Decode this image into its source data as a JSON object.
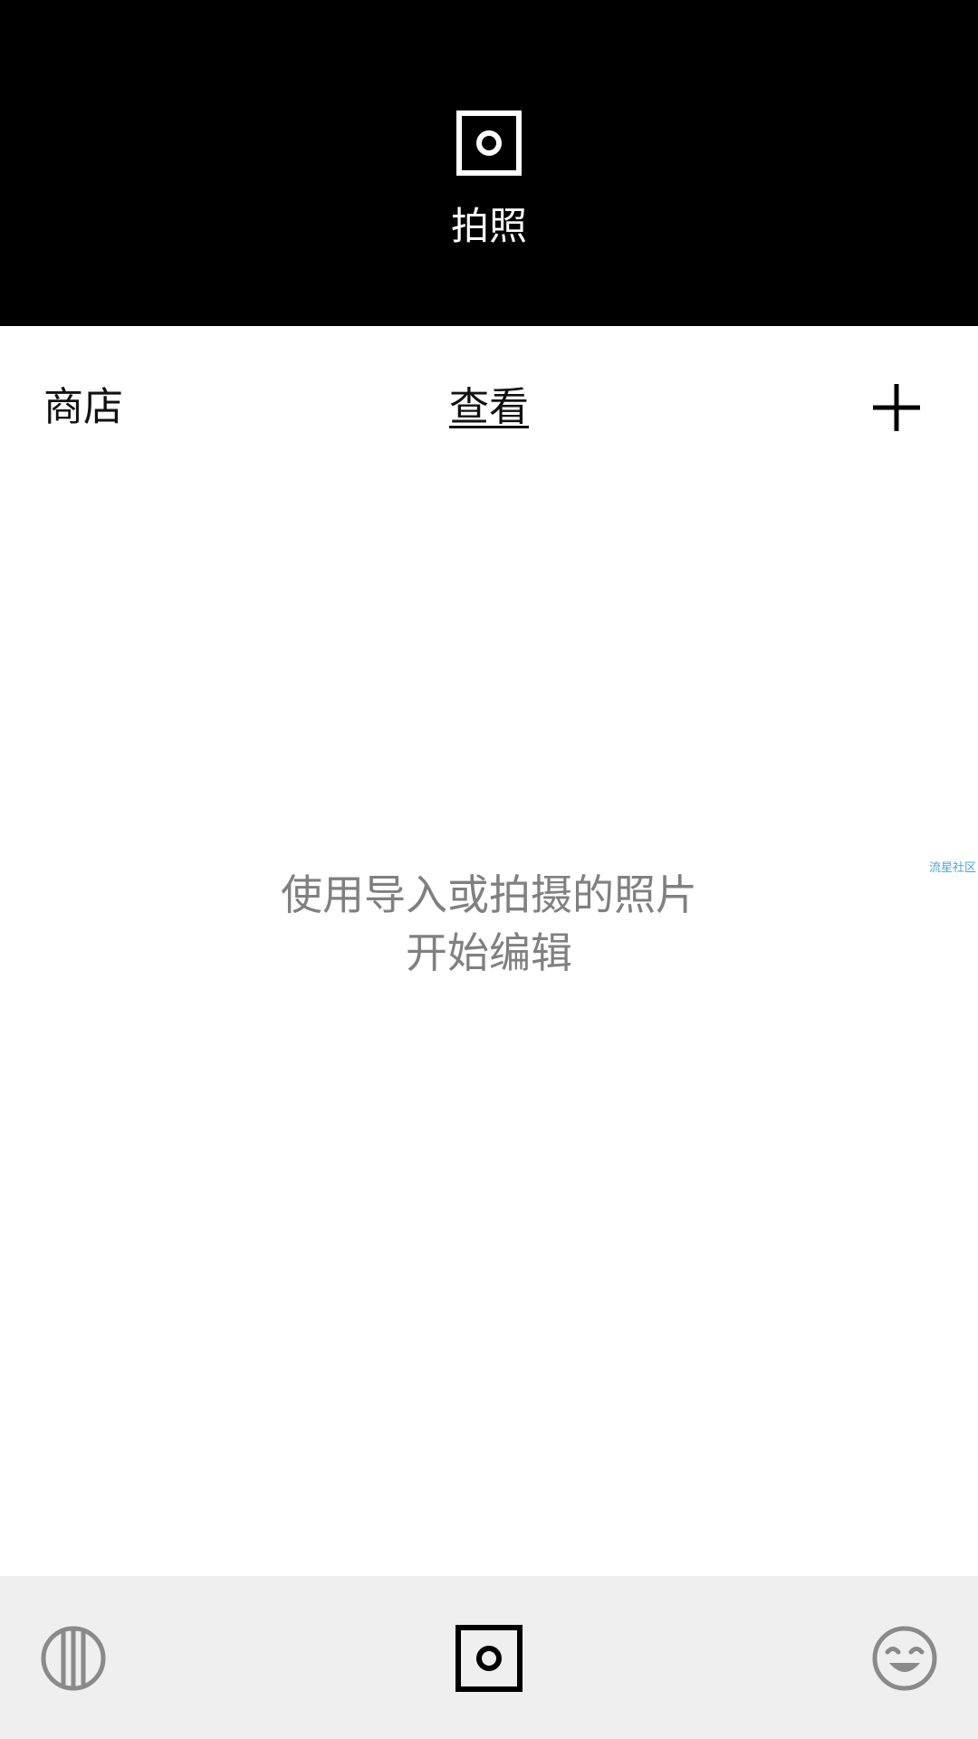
{
  "camera_banner": {
    "label": "拍照",
    "icon": "camera-shutter-icon"
  },
  "nav": {
    "store_label": "商店",
    "view_label": "查看",
    "add_icon": "plus-icon"
  },
  "empty_state": {
    "line1": "使用导入或拍摄的照片",
    "line2": "开始编辑"
  },
  "watermark": {
    "text": "流星社区"
  },
  "bottom_bar": {
    "left_icon": "filter-stripes-icon",
    "center_icon": "camera-shutter-icon",
    "right_icon": "smiley-face-icon"
  },
  "colors": {
    "banner_bg": "#000000",
    "bottom_bar_bg": "#efefef",
    "empty_text": "#808080",
    "icon_gray": "#8a8a8a",
    "watermark": "#4aa3d8"
  }
}
